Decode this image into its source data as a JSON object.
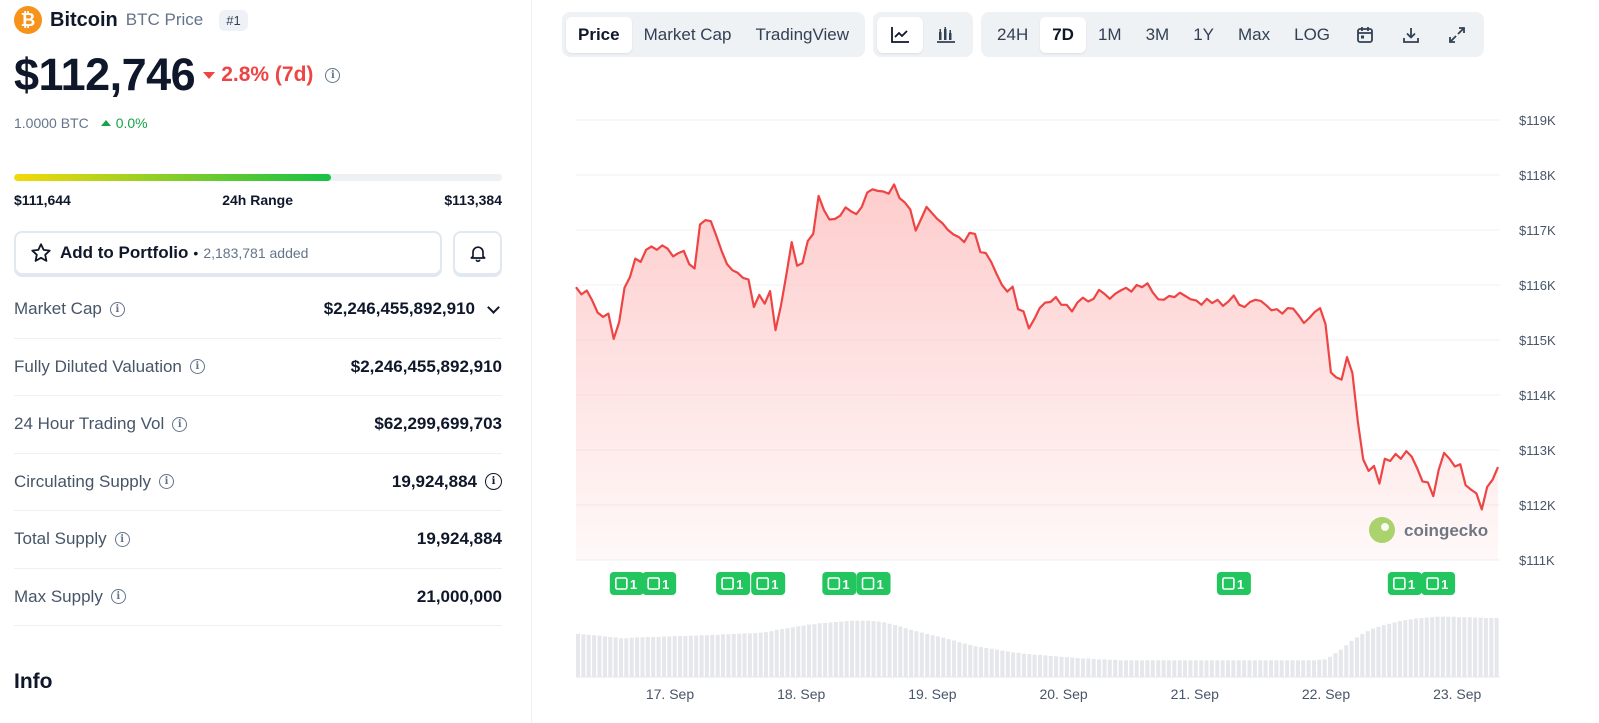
{
  "coin": {
    "name": "Bitcoin",
    "symbol_label": "BTC Price",
    "rank": "#1",
    "logo_glyph": "₿",
    "price": "$112,746",
    "change": "2.8% (7d)",
    "btc_value": "1.0000 BTC",
    "btc_change": "0.0%"
  },
  "range": {
    "low": "$111,644",
    "label": "24h Range",
    "high": "$113,384",
    "fill_percent": 65
  },
  "portfolio": {
    "label": "Add to Portfolio",
    "separator": "•",
    "count": "2,183,781 added"
  },
  "stats": [
    {
      "label": "Market Cap",
      "value": "$2,246,455,892,910"
    },
    {
      "label": "Fully Diluted Valuation",
      "value": "$2,246,455,892,910"
    },
    {
      "label": "24 Hour Trading Vol",
      "value": "$62,299,699,703"
    },
    {
      "label": "Circulating Supply",
      "value": "19,924,884"
    },
    {
      "label": "Total Supply",
      "value": "19,924,884"
    },
    {
      "label": "Max Supply",
      "value": "21,000,000"
    }
  ],
  "info_heading": "Info",
  "toolbar": {
    "views": [
      "Price",
      "Market Cap",
      "TradingView"
    ],
    "active_view": "Price",
    "ranges": [
      "24H",
      "7D",
      "1M",
      "3M",
      "1Y",
      "Max",
      "LOG"
    ],
    "active_range": "7D",
    "icons": [
      "line-chart-icon",
      "candlestick-icon",
      "calendar-icon",
      "download-icon",
      "expand-icon"
    ]
  },
  "colors": {
    "line": "#ef4444",
    "area": "#fecaca",
    "news_badge": "#22c55e",
    "volume": "#e5e7eb"
  },
  "chart_data": {
    "type": "area",
    "y_ticks": [
      "$119K",
      "$118K",
      "$117K",
      "$116K",
      "$115K",
      "$114K",
      "$113K",
      "$112K",
      "$111K"
    ],
    "ylim": [
      111000,
      119000
    ],
    "x_ticks": [
      "17. Sep",
      "18. Sep",
      "19. Sep",
      "20. Sep",
      "21. Sep",
      "22. Sep",
      "23. Sep"
    ],
    "watermark": "coingecko",
    "news_badge_label": "1",
    "price": [
      115960,
      115830,
      115900,
      115720,
      115500,
      115420,
      115480,
      115020,
      115320,
      115950,
      116140,
      116480,
      116420,
      116640,
      116700,
      116640,
      116720,
      116660,
      116520,
      116580,
      116620,
      116380,
      116300,
      117100,
      117180,
      117160,
      116900,
      116620,
      116380,
      116270,
      116220,
      116130,
      116100,
      115600,
      115820,
      115660,
      115890,
      115180,
      115620,
      116180,
      116780,
      116350,
      116400,
      116800,
      116930,
      117620,
      117360,
      117190,
      117200,
      117260,
      117410,
      117340,
      117290,
      117420,
      117680,
      117740,
      117710,
      117700,
      117660,
      117830,
      117580,
      117500,
      117370,
      116990,
      117200,
      117420,
      117310,
      117200,
      117120,
      117000,
      116920,
      116870,
      116780,
      116950,
      116930,
      116600,
      116580,
      116420,
      116200,
      116000,
      115880,
      115970,
      115560,
      115520,
      115210,
      115380,
      115580,
      115680,
      115690,
      115780,
      115640,
      115640,
      115520,
      115680,
      115770,
      115700,
      115750,
      115910,
      115840,
      115750,
      115840,
      115900,
      115950,
      115880,
      116000,
      115960,
      116030,
      115860,
      115740,
      115730,
      115800,
      115780,
      115860,
      115800,
      115740,
      115720,
      115640,
      115750,
      115670,
      115730,
      115620,
      115700,
      115810,
      115640,
      115600,
      115690,
      115730,
      115710,
      115630,
      115540,
      115560,
      115480,
      115580,
      115570,
      115450,
      115310,
      115400,
      115510,
      115580,
      115290,
      114410,
      114320,
      114280,
      114690,
      114400,
      113520,
      112830,
      112620,
      112710,
      112390,
      112840,
      112800,
      112930,
      112840,
      112980,
      112880,
      112670,
      112430,
      112410,
      112160,
      112640,
      112950,
      112840,
      112700,
      112740,
      112360,
      112280,
      112210,
      111920,
      112330,
      112460,
      112690
    ],
    "volume_relative": [
      0.98,
      0.97,
      0.96,
      0.95,
      0.94,
      0.92,
      0.91,
      0.9,
      0.88,
      0.88,
      0.89,
      0.9,
      0.9,
      0.91,
      0.91,
      0.91,
      0.92,
      0.92,
      0.93,
      0.93,
      0.93,
      0.94,
      0.94,
      0.95,
      0.95,
      0.96,
      0.96,
      0.97,
      0.97,
      0.98,
      0.98,
      0.99,
      0.99,
      1.0,
      1.01,
      1.02,
      1.04,
      1.07,
      1.09,
      1.11,
      1.13,
      1.15,
      1.17,
      1.19,
      1.2,
      1.22,
      1.23,
      1.24,
      1.25,
      1.26,
      1.27,
      1.28,
      1.28,
      1.28,
      1.28,
      1.27,
      1.26,
      1.24,
      1.21,
      1.18,
      1.15,
      1.11,
      1.07,
      1.04,
      1.01,
      0.98,
      0.95,
      0.92,
      0.89,
      0.86,
      0.83,
      0.79,
      0.76,
      0.73,
      0.7,
      0.68,
      0.66,
      0.64,
      0.62,
      0.6,
      0.58,
      0.56,
      0.55,
      0.53,
      0.52,
      0.51,
      0.5,
      0.49,
      0.48,
      0.47,
      0.46,
      0.45,
      0.44,
      0.43,
      0.42,
      0.42,
      0.41,
      0.4,
      0.4,
      0.39,
      0.39,
      0.38,
      0.38,
      0.38,
      0.38,
      0.38,
      0.38,
      0.38,
      0.38,
      0.38,
      0.38,
      0.38,
      0.38,
      0.38,
      0.38,
      0.38,
      0.38,
      0.38,
      0.38,
      0.38,
      0.38,
      0.38,
      0.38,
      0.38,
      0.38,
      0.38,
      0.38,
      0.38,
      0.38,
      0.38,
      0.38,
      0.38,
      0.38,
      0.38,
      0.38,
      0.38,
      0.38,
      0.38,
      0.39,
      0.4,
      0.46,
      0.54,
      0.62,
      0.72,
      0.82,
      0.9,
      0.98,
      1.04,
      1.1,
      1.14,
      1.18,
      1.21,
      1.24,
      1.27,
      1.29,
      1.31,
      1.33,
      1.34,
      1.35,
      1.36,
      1.37,
      1.37,
      1.37,
      1.37,
      1.36,
      1.36,
      1.36,
      1.35,
      1.35,
      1.34,
      1.34,
      1.34
    ],
    "news_markers": [
      {
        "label": "1",
        "position": 0.055
      },
      {
        "label": "1",
        "position": 0.09
      },
      {
        "label": "1",
        "position": 0.17
      },
      {
        "label": "1",
        "position": 0.208
      },
      {
        "label": "1",
        "position": 0.285
      },
      {
        "label": "1",
        "position": 0.322
      },
      {
        "label": "1",
        "position": 0.712
      },
      {
        "label": "1",
        "position": 0.897
      },
      {
        "label": "1",
        "position": 0.933
      }
    ]
  }
}
